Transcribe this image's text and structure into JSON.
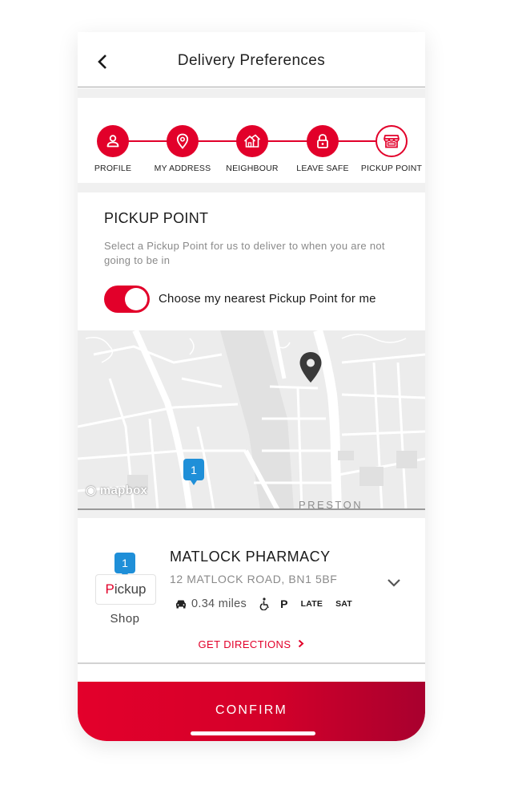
{
  "header": {
    "title": "Delivery Preferences"
  },
  "steps": [
    {
      "label": "PROFILE",
      "icon": "person-icon"
    },
    {
      "label": "MY ADDRESS",
      "icon": "location-pin-icon"
    },
    {
      "label": "NEIGHBOUR",
      "icon": "houses-icon"
    },
    {
      "label": "LEAVE SAFE",
      "icon": "lock-icon"
    },
    {
      "label": "PICKUP POINT",
      "icon": "shop-icon"
    }
  ],
  "pickup": {
    "title": "PICKUP POINT",
    "description": "Select a Pickup Point for us to deliver to when you are not going to be in",
    "toggle_label": "Choose my nearest Pickup Point for me",
    "toggle_on": true
  },
  "map": {
    "provider_logo": "mapbox",
    "place_label": "PRESTON",
    "marker_number": "1"
  },
  "location": {
    "badge_number": "1",
    "logo_text_accent": "P",
    "logo_text_rest": "ickup",
    "type": "Shop",
    "name": "MATLOCK PHARMACY",
    "address": "12 MATLOCK ROAD, BN1 5BF",
    "distance": "0.34 miles",
    "features": [
      "P",
      "LATE",
      "SAT"
    ],
    "directions_label": "GET DIRECTIONS"
  },
  "footer": {
    "confirm_label": "CONFIRM"
  },
  "colors": {
    "accent": "#e2002a",
    "marker_blue": "#1f8fd8"
  }
}
